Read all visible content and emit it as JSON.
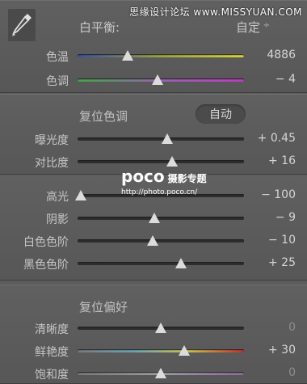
{
  "watermark": "思缘设计论坛 www.MISSYUAN.COM",
  "white_balance": {
    "label": "白平衡:",
    "value": "自定",
    "caret": "÷",
    "sliders": [
      {
        "label": "色温",
        "value": "4886",
        "level": 0.3,
        "track": "temp"
      },
      {
        "label": "色调",
        "value": "− 4",
        "level": 0.48,
        "track": "tint"
      }
    ]
  },
  "tone": {
    "title": "复位色调",
    "auto_label": "自动",
    "sliders": [
      {
        "label": "曝光度",
        "value": "+ 0.45",
        "level": 0.54
      },
      {
        "label": "对比度",
        "value": "+ 16",
        "level": 0.57
      }
    ]
  },
  "branding": {
    "name": "poco",
    "subtitle": "摄影专题",
    "url": "http://photo.poco.cn/"
  },
  "tone2": {
    "sliders": [
      {
        "label": "高光",
        "value": "− 100",
        "level": 0.02
      },
      {
        "label": "阴影",
        "value": "− 9",
        "level": 0.46
      },
      {
        "label": "白色色阶",
        "value": "− 10",
        "level": 0.45
      },
      {
        "label": "黑色色阶",
        "value": "+ 25",
        "level": 0.62
      }
    ]
  },
  "presence": {
    "title": "复位偏好",
    "sliders": [
      {
        "label": "清晰度",
        "value": "0",
        "level": 0.5,
        "dim": true
      },
      {
        "label": "鲜艳度",
        "value": "+ 30",
        "level": 0.64,
        "track": "vib"
      },
      {
        "label": "饱和度",
        "value": "0",
        "level": 0.5,
        "dim": true,
        "track": "sat"
      }
    ]
  },
  "colors": {
    "temp": [
      "#3a4fa8",
      "#9ba340",
      "#d8d23a"
    ],
    "tint": [
      "#3fa847",
      "#9a62b0",
      "#c03bc4"
    ]
  }
}
